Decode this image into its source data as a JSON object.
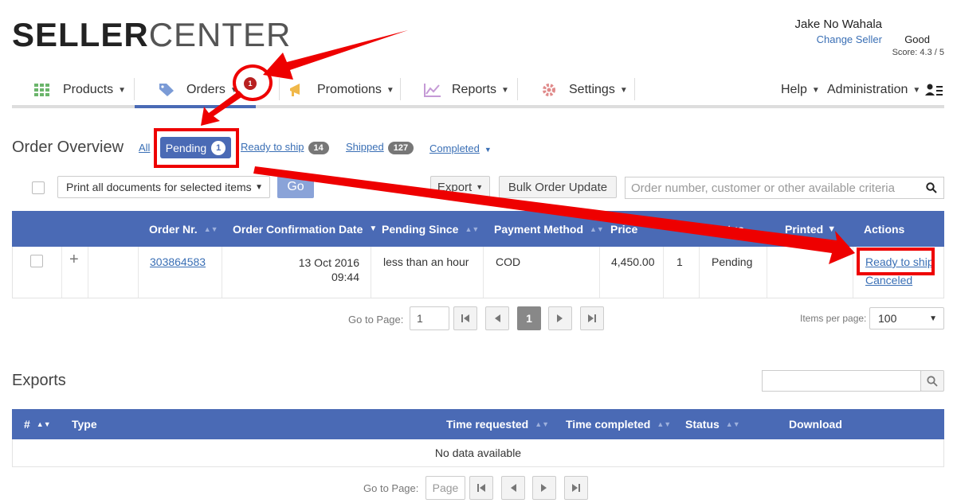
{
  "brand": {
    "bold": "SELLER",
    "light": "CENTER"
  },
  "user": {
    "name": "Jake No Wahala",
    "change_seller": "Change Seller",
    "rating": "Good",
    "score": "Score: 4.3 / 5"
  },
  "nav": {
    "products": "Products",
    "orders": "Orders",
    "orders_badge": "1",
    "promotions": "Promotions",
    "reports": "Reports",
    "settings": "Settings",
    "help": "Help",
    "administration": "Administration"
  },
  "overview": {
    "title": "Order Overview",
    "tabs": {
      "all": "All",
      "pending": "Pending",
      "pending_count": "1",
      "ready": "Ready to ship",
      "ready_count": "14",
      "shipped": "Shipped",
      "shipped_count": "127",
      "completed": "Completed"
    },
    "print_select": "Print all documents for selected items",
    "go": "Go",
    "export": "Export",
    "bulk_update": "Bulk Order Update",
    "search_placeholder": "Order number, customer or other available criteria"
  },
  "orders_table": {
    "headers": {
      "order_nr": "Order Nr.",
      "confirmation_date": "Order Confirmation Date",
      "pending_since": "Pending Since",
      "payment_method": "Payment Method",
      "price": "Price",
      "status": "Status",
      "printed": "Printed",
      "actions": "Actions"
    },
    "rows": [
      {
        "order_nr": "303864583",
        "date": "13 Oct 2016",
        "time": "09:44",
        "pending_since": "less than an hour",
        "payment_method": "COD",
        "price": "4,450.00",
        "qty": "1",
        "status": "Pending",
        "action_ready": "Ready to ship",
        "action_cancel": "Canceled"
      }
    ]
  },
  "pagination": {
    "label": "Go to Page:",
    "page_value": "1",
    "current_page": "1",
    "items_label": "Items per page:",
    "items_value": "100"
  },
  "exports": {
    "title": "Exports",
    "headers": {
      "num": "#",
      "type": "Type",
      "time_requested": "Time requested",
      "time_completed": "Time completed",
      "status": "Status",
      "download": "Download"
    },
    "empty": "No data available",
    "page_label": "Go to Page:",
    "page_placeholder": "Page"
  }
}
